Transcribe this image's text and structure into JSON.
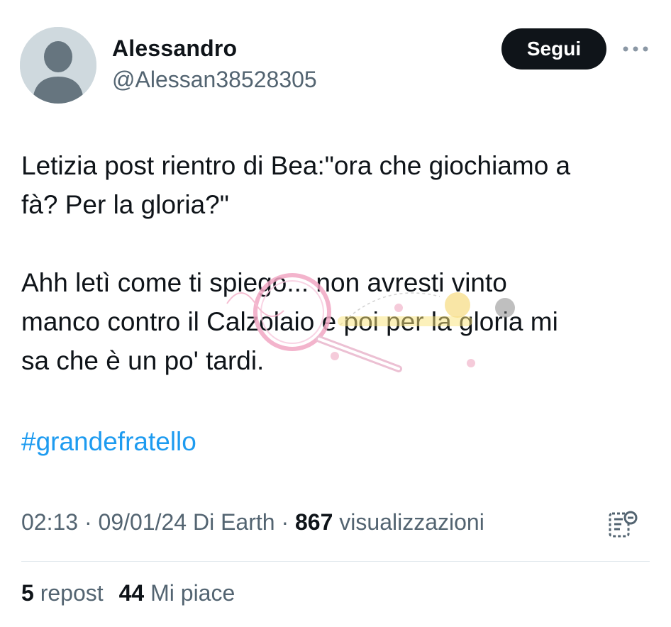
{
  "author": {
    "name": "Alessandro",
    "handle": "@Alessan38528305",
    "avatar_icon": "default-avatar-icon"
  },
  "follow_button": {
    "label": "Segui"
  },
  "more_icon": "more-options-icon",
  "post": {
    "text": "Letizia post rientro di Bea:\"ora che giochiamo a\nfà? Per la gloria?\"\n\nAhh letì come ti spiego... non avresti vinto\nmanco contro il Calzolaio e poi per la gloria mi\nsa che è un po' tardi.",
    "hashtag": "#grandefratello"
  },
  "meta": {
    "time": "02:13",
    "sep1": " · ",
    "date": "09/01/24",
    "source": "Di Earth",
    "sep2": " · ",
    "views_count": "867",
    "views_label": "visualizzazioni"
  },
  "analytics_icon": "post-analytics-icon",
  "stats": {
    "reposts_count": "5",
    "reposts_label": "repost",
    "likes_count": "44",
    "likes_label": "Mi piace"
  },
  "colors": {
    "text": "#0f1419",
    "secondary": "#536471",
    "link": "#1d9bf0",
    "button_bg": "#0f1419",
    "avatar_bg": "#cfd9de"
  }
}
